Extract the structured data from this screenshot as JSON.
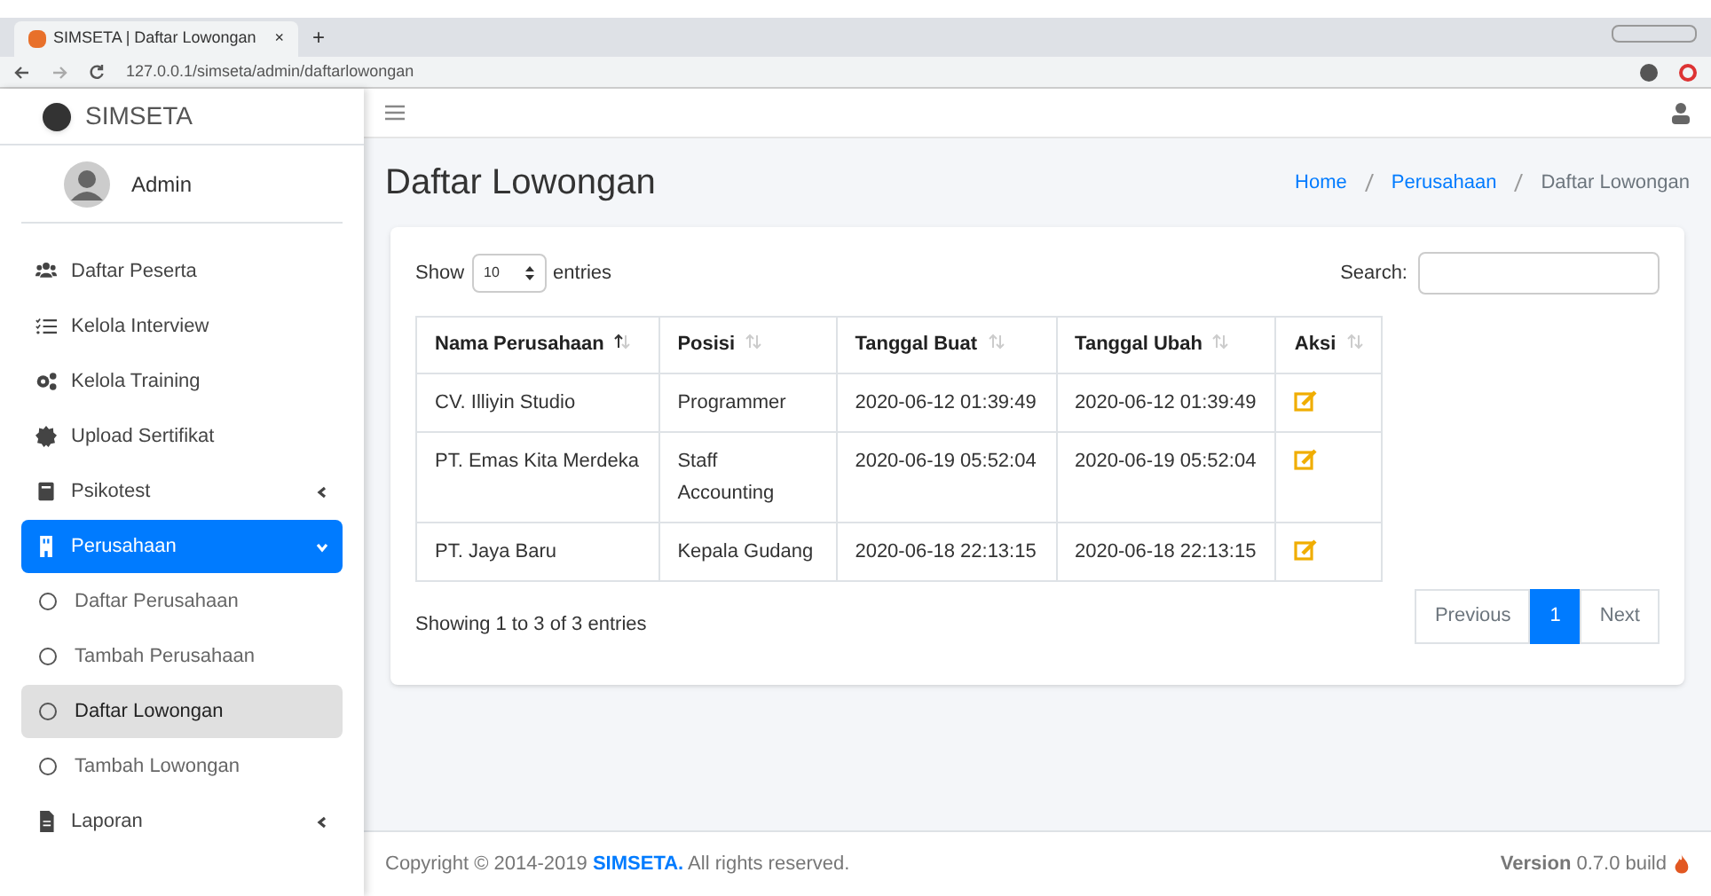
{
  "browser": {
    "tab_title": "SIMSETA | Daftar Lowongan",
    "tab_close": "×",
    "new_tab": "+",
    "url": "127.0.0.1/simseta/admin/daftarlowongan"
  },
  "sidebar": {
    "brand": "SIMSETA",
    "user": "Admin",
    "items": [
      {
        "label": "Daftar Peserta",
        "kind": "users",
        "selected": false
      },
      {
        "label": "Kelola Interview",
        "kind": "list",
        "selected": false
      },
      {
        "label": "Kelola Training",
        "kind": "gears",
        "selected": false
      },
      {
        "label": "Upload Sertifikat",
        "kind": "badge",
        "selected": false
      },
      {
        "label": "Psikotest",
        "kind": "book",
        "selected": false,
        "expanded": false
      },
      {
        "label": "Perusahaan",
        "kind": "building",
        "selected": true,
        "expanded": true,
        "children": [
          {
            "label": "Daftar Perusahaan",
            "selected": false
          },
          {
            "label": "Tambah Perusahaan",
            "selected": false
          },
          {
            "label": "Daftar Lowongan",
            "selected": true
          },
          {
            "label": "Tambah Lowongan",
            "selected": false
          }
        ]
      },
      {
        "label": "Laporan",
        "kind": "file",
        "selected": false,
        "expanded": false
      }
    ]
  },
  "page": {
    "title": "Daftar Lowongan",
    "breadcrumb": [
      {
        "label": "Home",
        "link": true
      },
      {
        "label": "Perusahaan",
        "link": true
      },
      {
        "label": "Daftar Lowongan",
        "link": false
      }
    ]
  },
  "table_controls": {
    "show": "Show",
    "entries_value": "10",
    "entries": "entries",
    "search_label": "Search:"
  },
  "table": {
    "columns": [
      {
        "label": "Nama Perusahaan",
        "sorted": true
      },
      {
        "label": "Posisi",
        "sorted": false
      },
      {
        "label": "Tanggal Buat",
        "sorted": false
      },
      {
        "label": "Tanggal Ubah",
        "sorted": false
      },
      {
        "label": "Aksi",
        "sorted": false
      }
    ],
    "rows": [
      [
        "CV. Illiyin Studio",
        "Programmer",
        "2020-06-12 01:39:49",
        "2020-06-12 01:39:49"
      ],
      [
        "PT. Emas Kita Merdeka",
        "Staff Accounting",
        "2020-06-19 05:52:04",
        "2020-06-19 05:52:04"
      ],
      [
        "PT. Jaya Baru",
        "Kepala Gudang",
        "2020-06-18 22:13:15",
        "2020-06-18 22:13:15"
      ]
    ]
  },
  "info": "Showing 1 to 3 of 3 entries",
  "pagination": [
    {
      "label": "Previous",
      "selected": false
    },
    {
      "label": "1",
      "selected": true
    },
    {
      "label": "Next",
      "selected": false
    }
  ],
  "footer": {
    "copyright": "Copyright © 2014-2019 **SIMSETA.** All rights reserved.",
    "version": "**Version** 0.7.0 build"
  }
}
